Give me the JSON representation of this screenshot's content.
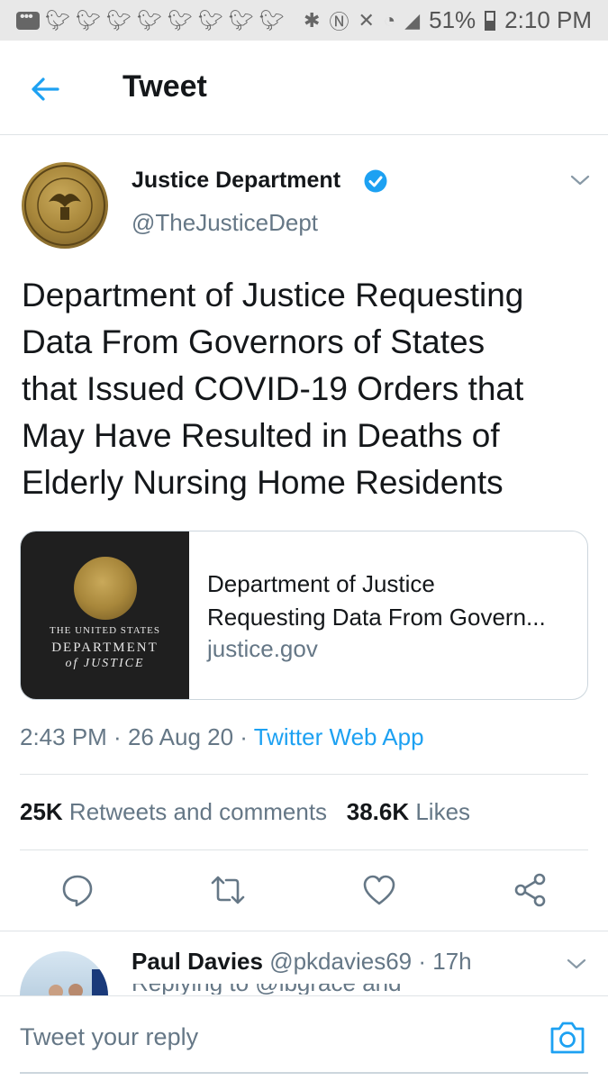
{
  "status_bar": {
    "battery": "51%",
    "time": "2:10 PM",
    "notification_icons": [
      "message-icon",
      "twitter-icon",
      "twitter-icon",
      "twitter-icon",
      "twitter-icon",
      "twitter-icon",
      "twitter-icon",
      "twitter-icon",
      "twitter-icon"
    ],
    "system_icons": [
      "bluetooth-icon",
      "nfc-icon",
      "mute-icon",
      "wifi-icon",
      "signal-icon"
    ]
  },
  "header": {
    "title": "Tweet"
  },
  "tweet": {
    "author_name": "Justice Department",
    "author_handle": "@TheJusticeDept",
    "text_lines": [
      "Department of Justice Requesting",
      "Data From Governors of States",
      "that Issued COVID-19 Orders that",
      "May Have Resulted in Deaths of",
      "Elderly Nursing Home Residents"
    ],
    "card": {
      "image_line1": "THE UNITED STATES",
      "image_line2": "DEPARTMENT",
      "image_line3": "of JUSTICE",
      "title_line1": "Department of Justice",
      "title_line2": "Requesting Data From Govern...",
      "domain": "justice.gov"
    },
    "time": "2:43 PM",
    "dot1": " · ",
    "date": "26 Aug 20",
    "dot2": " · ",
    "app": "Twitter Web App",
    "retweets_count": "25K",
    "retweets_label": " Retweets and comments",
    "likes_count": "38.6K",
    "likes_label": " Likes"
  },
  "reply": {
    "name": "Paul Davies",
    "handle": " @pkdavies69",
    "time": " · 17h",
    "snippet": "Replying to @lbgrace and"
  },
  "composer": {
    "placeholder": "Tweet your reply"
  },
  "colors": {
    "accent": "#1da1f2",
    "text": "#14171a",
    "secondary": "#657786",
    "border": "#dfe3e6"
  }
}
